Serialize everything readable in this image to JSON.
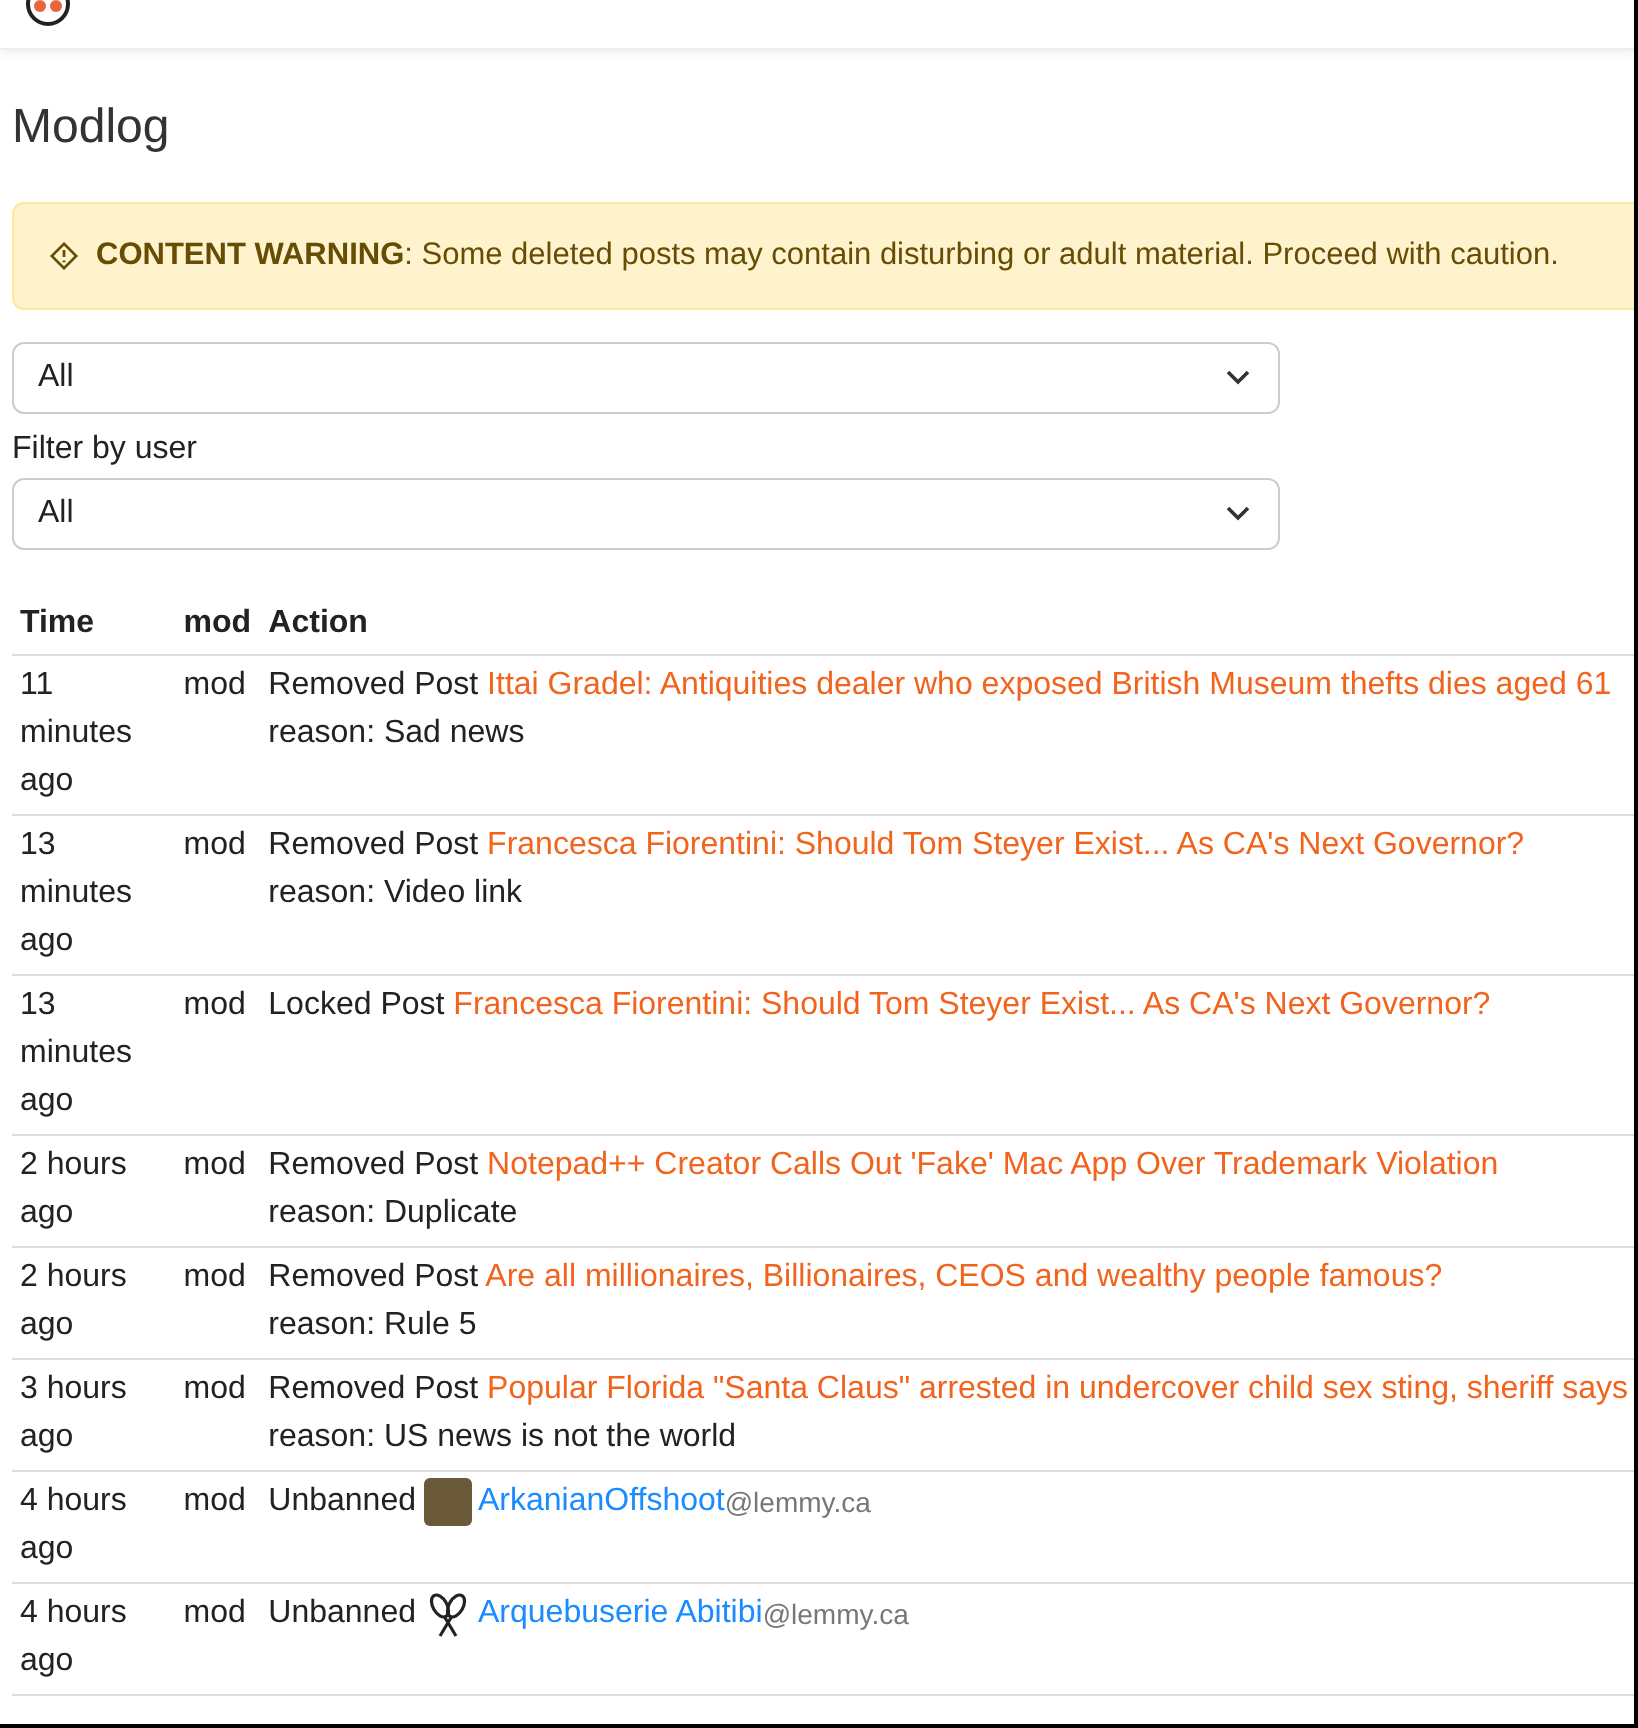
{
  "page_title": "Modlog",
  "warning": {
    "label": "CONTENT WARNING",
    "text": ": Some deleted posts may contain disturbing or adult material. Proceed with caution."
  },
  "action_filter": {
    "value": "All"
  },
  "user_filter": {
    "label": "Filter by user",
    "value": "All"
  },
  "table": {
    "columns": [
      "Time",
      "mod",
      "Action"
    ],
    "rows": [
      {
        "kind": "post",
        "time": "11 minutes ago",
        "mod": "mod",
        "verb": "Removed Post",
        "link": "Ittai Gradel: Antiquities dealer who exposed British Museum thefts dies aged 61",
        "reason": "reason: Sad news"
      },
      {
        "kind": "post",
        "time": "13 minutes ago",
        "mod": "mod",
        "verb": "Removed Post",
        "link": "Francesca Fiorentini: Should Tom Steyer Exist... As CA's Next Governor?",
        "reason": "reason: Video link"
      },
      {
        "kind": "post",
        "time": "13 minutes ago",
        "mod": "mod",
        "verb": "Locked Post",
        "link": "Francesca Fiorentini: Should Tom Steyer Exist... As CA's Next Governor?"
      },
      {
        "kind": "post",
        "time": "2 hours ago",
        "mod": "mod",
        "verb": "Removed Post",
        "link": "Notepad++ Creator Calls Out 'Fake' Mac App Over Trademark Violation",
        "reason": "reason: Duplicate"
      },
      {
        "kind": "post",
        "time": "2 hours ago",
        "mod": "mod",
        "verb": "Removed Post",
        "link": "Are all millionaires, Billionaires, CEOS and wealthy people famous?",
        "reason": "reason: Rule 5"
      },
      {
        "kind": "post",
        "time": "3 hours ago",
        "mod": "mod",
        "verb": "Removed Post",
        "link": "Popular Florida \"Santa Claus\" arrested in undercover child sex sting, sheriff says",
        "reason": "reason: US news is not the world"
      },
      {
        "kind": "user",
        "time": "4 hours ago",
        "mod": "mod",
        "verb": "Unbanned",
        "avatar": {
          "kind": "photo"
        },
        "user": "ArkanianOffshoot",
        "instance": "@lemmy.ca"
      },
      {
        "kind": "user",
        "time": "4 hours ago",
        "mod": "mod",
        "verb": "Unbanned",
        "avatar": {
          "kind": "snowshoes"
        },
        "user": "Arquebuserie Abitibi",
        "instance": "@lemmy.ca"
      }
    ]
  }
}
